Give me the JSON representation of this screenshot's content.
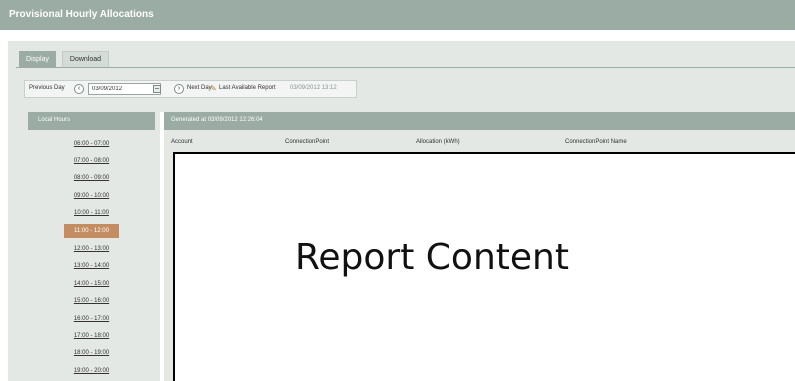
{
  "header": {
    "title": "Provisional Hourly Allocations"
  },
  "tabs": [
    {
      "label": "Display",
      "active": true
    },
    {
      "label": "Download",
      "active": false
    }
  ],
  "toolbar": {
    "prev_label": "Previous Day",
    "date_value": "03/09/2012",
    "next_label": "Next Day",
    "last_report_label": "Last Available Report",
    "last_report_time": "03/09/2012 13:12"
  },
  "hours": {
    "header": "Local Hours",
    "items": [
      {
        "label": "06:00 - 07:00",
        "active": false
      },
      {
        "label": "07:00 - 08:00",
        "active": false
      },
      {
        "label": "08:00 - 09:00",
        "active": false
      },
      {
        "label": "09:00 - 10:00",
        "active": false
      },
      {
        "label": "10:00 - 11:00",
        "active": false
      },
      {
        "label": "11:00 - 12:00",
        "active": true
      },
      {
        "label": "12:00 - 13:00",
        "active": false
      },
      {
        "label": "13:00 - 14:00",
        "active": false
      },
      {
        "label": "14:00 - 15:00",
        "active": false
      },
      {
        "label": "15:00 - 16:00",
        "active": false
      },
      {
        "label": "16:00 - 17:00",
        "active": false
      },
      {
        "label": "17:00 - 18:00",
        "active": false
      },
      {
        "label": "18:00 - 19:00",
        "active": false
      },
      {
        "label": "19:00 - 20:00",
        "active": false
      }
    ]
  },
  "report": {
    "generated": "Generated at 03/09/2012 12:26:04",
    "columns": [
      "Account",
      "ConnectionPoint",
      "Allocation (kWh)",
      "ConnectionPoint Name"
    ],
    "placeholder": "Report Content"
  },
  "colors": {
    "header_bg": "#9aaca4",
    "panel_bg": "#e3e8e5",
    "active_hour": "#c38d61"
  }
}
